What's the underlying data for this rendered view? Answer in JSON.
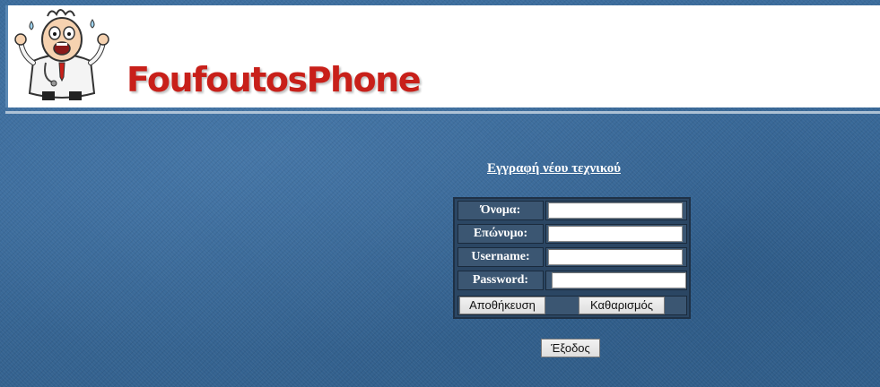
{
  "header": {
    "brand": "FoufoutosPhone",
    "mascot_icon": "panicked-doctor-mascot-icon"
  },
  "form": {
    "title": "Εγγραφή νέου τεχνικού",
    "fields": [
      {
        "label": "Όνομα:",
        "value": "",
        "placeholder": ""
      },
      {
        "label": "Επώνυμο:",
        "value": "",
        "placeholder": ""
      },
      {
        "label": "Username:",
        "value": "",
        "placeholder": ""
      },
      {
        "label": "Password:",
        "value": "",
        "placeholder": ""
      }
    ],
    "save_label": "Αποθήκευση",
    "clear_label": "Καθαρισμός"
  },
  "exit_label": "Έξοδος",
  "colors": {
    "brand": "#c8201a",
    "background": "#3f6f9e",
    "form_background": "#2b4663"
  }
}
